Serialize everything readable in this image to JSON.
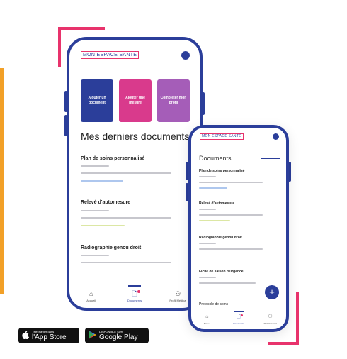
{
  "brand_logo": "MON ESPACE SANTÉ",
  "main_phone": {
    "tiles": [
      {
        "label": "Ajouter un document",
        "color": "#2B3E9A"
      },
      {
        "label": "Ajouter une mesure",
        "color": "#D93A8C"
      },
      {
        "label": "Compléter mon profil",
        "color": "#A55DB8"
      }
    ],
    "section_title": "Mes derniers documents",
    "documents": [
      "Plan de soins personnalisé",
      "Relevé d'automesure",
      "Radiographie genou droit"
    ],
    "tabs": [
      {
        "icon": "home-icon",
        "label": "Accueil",
        "glyph": "⌂"
      },
      {
        "icon": "document-icon",
        "label": "Documents",
        "glyph": "🗋"
      },
      {
        "icon": "user-icon",
        "label": "Profil Médical",
        "glyph": "⚇"
      }
    ]
  },
  "second_phone": {
    "header": "Documents",
    "documents": [
      "Plan de soins personnalisé",
      "Relevé d'automesure",
      "Radiographie genou droit",
      "Fiche de liaison d'urgence",
      "Protocole de soins"
    ],
    "fab_glyph": "+",
    "tabs": [
      {
        "icon": "home-icon",
        "label": "Accueil",
        "glyph": "⌂"
      },
      {
        "icon": "document-icon",
        "label": "Documents",
        "glyph": "🗋"
      },
      {
        "icon": "user-icon",
        "label": "Profil Médical",
        "glyph": "⚇"
      }
    ]
  },
  "colors": {
    "primary": "#2B3E9A",
    "pink": "#E8336C",
    "orange": "#F2A027"
  },
  "store_badges": {
    "apple_small": "Télécharger dans",
    "apple_big": "l'App Store",
    "google_small": "DISPONIBLE SUR",
    "google_big": "Google Play"
  }
}
